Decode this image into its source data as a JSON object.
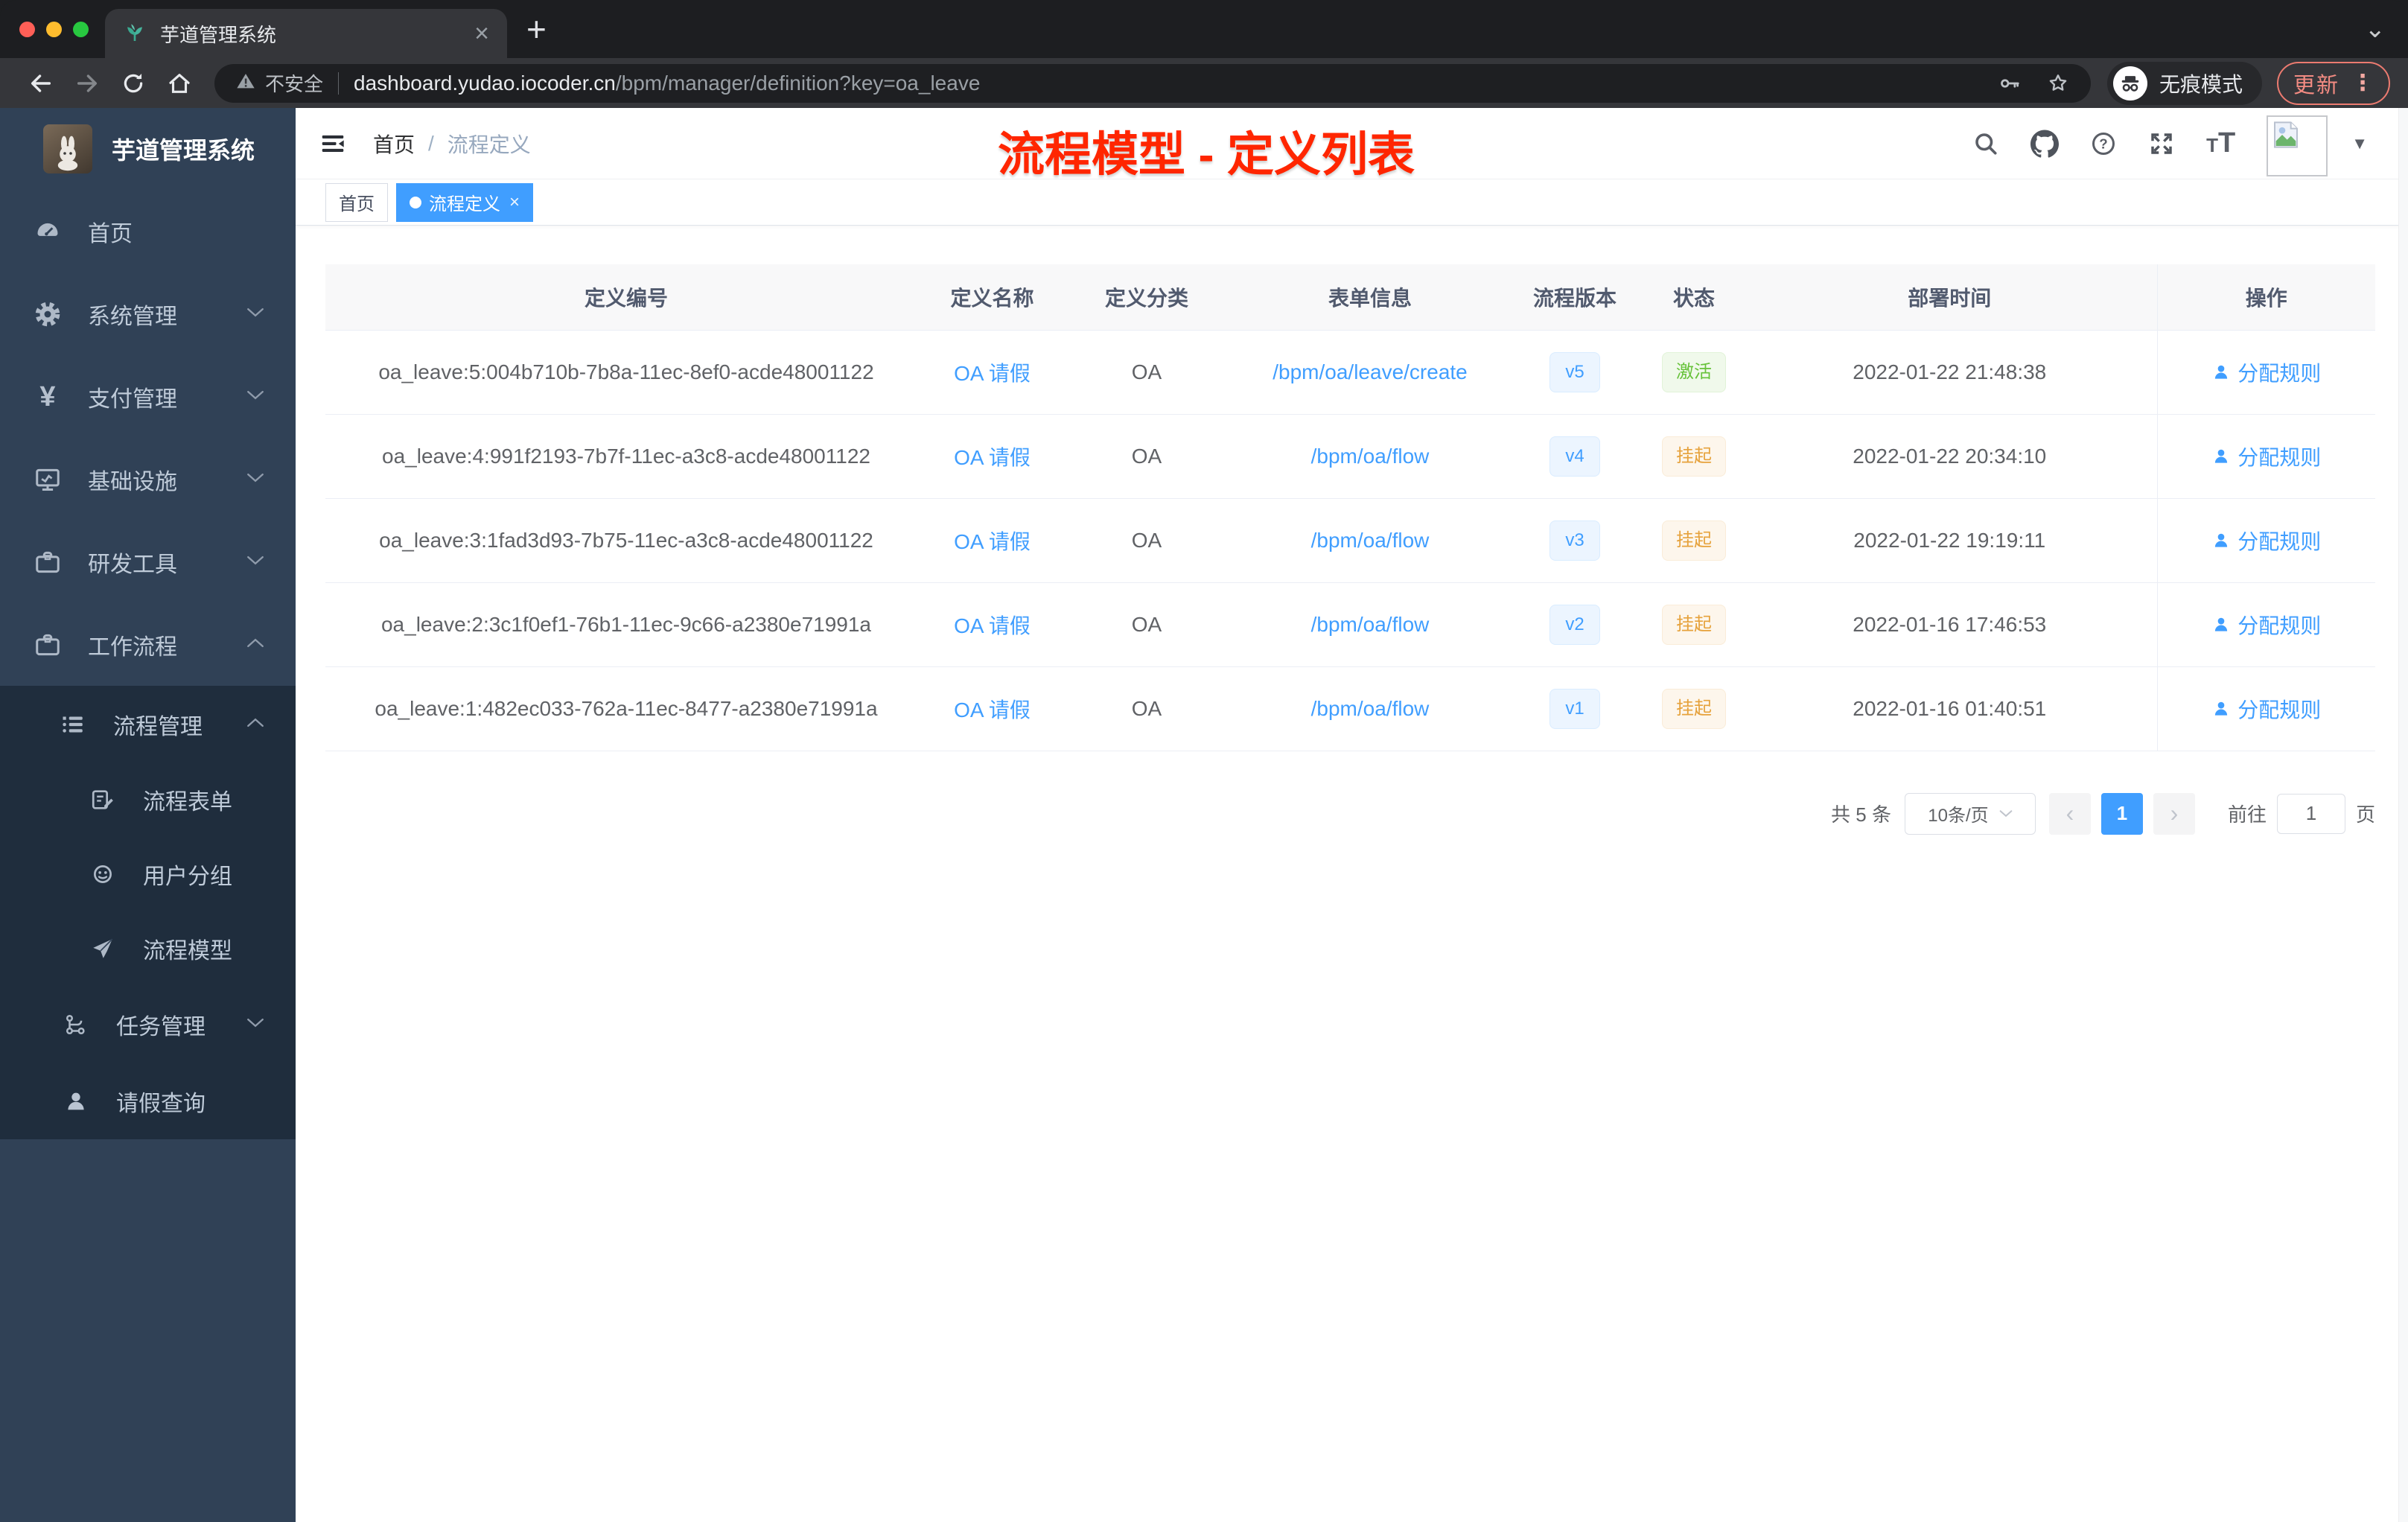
{
  "browser": {
    "tab": {
      "title": "芋道管理系统"
    },
    "toolbar": {
      "security_label": "不安全",
      "url_host": "dashboard.yudao.iocoder.cn",
      "url_path": "/bpm/manager/definition?key=oa_leave",
      "incognito_label": "无痕模式",
      "update_label": "更新"
    }
  },
  "glyphs": {
    "close": "×",
    "plus": "+",
    "chevron_down": "⌄",
    "prev": "‹",
    "next": "›",
    "kebab": "⋮",
    "caret": "▼"
  },
  "sidebar": {
    "app_title": "芋道管理系统",
    "menu": [
      {
        "label": "首页",
        "icon": "dashboard-icon",
        "expandable": false
      },
      {
        "label": "系统管理",
        "icon": "gear-icon",
        "state": "collapsed"
      },
      {
        "label": "支付管理",
        "icon": "yen-icon",
        "state": "collapsed"
      },
      {
        "label": "基础设施",
        "icon": "monitor-icon",
        "state": "collapsed"
      },
      {
        "label": "研发工具",
        "icon": "briefcase-icon",
        "state": "collapsed"
      },
      {
        "label": "工作流程",
        "icon": "briefcase-icon",
        "state": "expanded"
      }
    ],
    "submenu": [
      {
        "label": "流程管理",
        "icon": "tree-list-icon",
        "state": "expanded"
      },
      {
        "label": "流程表单",
        "icon": "form-edit-icon"
      },
      {
        "label": "用户分组",
        "icon": "robot-face-icon"
      },
      {
        "label": "流程模型",
        "icon": "paper-plane-icon"
      },
      {
        "label": "任务管理",
        "icon": "branch-icon",
        "state": "collapsed"
      },
      {
        "label": "请假查询",
        "icon": "user-icon"
      }
    ]
  },
  "header": {
    "breadcrumb": {
      "root": "首页",
      "separator": "/",
      "current": "流程定义"
    },
    "annotation": {
      "text": "流程模型 - 定义列表",
      "color": "#ff2600"
    }
  },
  "tags": {
    "home": "首页",
    "current": "流程定义"
  },
  "table": {
    "columns": [
      "定义编号",
      "定义名称",
      "定义分类",
      "表单信息",
      "流程版本",
      "状态",
      "部署时间",
      "操作"
    ],
    "action_label": "分配规则",
    "rows": [
      {
        "id": "oa_leave:5:004b710b-7b8a-11ec-8ef0-acde48001122",
        "name": "OA 请假",
        "category": "OA",
        "form": "/bpm/oa/leave/create",
        "version": "v5",
        "status": "激活",
        "status_type": "success",
        "deployed": "2022-01-22 21:48:38"
      },
      {
        "id": "oa_leave:4:991f2193-7b7f-11ec-a3c8-acde48001122",
        "name": "OA 请假",
        "category": "OA",
        "form": "/bpm/oa/flow",
        "version": "v4",
        "status": "挂起",
        "status_type": "warning",
        "deployed": "2022-01-22 20:34:10"
      },
      {
        "id": "oa_leave:3:1fad3d93-7b75-11ec-a3c8-acde48001122",
        "name": "OA 请假",
        "category": "OA",
        "form": "/bpm/oa/flow",
        "version": "v3",
        "status": "挂起",
        "status_type": "warning",
        "deployed": "2022-01-22 19:19:11"
      },
      {
        "id": "oa_leave:2:3c1f0ef1-76b1-11ec-9c66-a2380e71991a",
        "name": "OA 请假",
        "category": "OA",
        "form": "/bpm/oa/flow",
        "version": "v2",
        "status": "挂起",
        "status_type": "warning",
        "deployed": "2022-01-16 17:46:53"
      },
      {
        "id": "oa_leave:1:482ec033-762a-11ec-8477-a2380e71991a",
        "name": "OA 请假",
        "category": "OA",
        "form": "/bpm/oa/flow",
        "version": "v1",
        "status": "挂起",
        "status_type": "warning",
        "deployed": "2022-01-16 01:40:51"
      }
    ]
  },
  "pagination": {
    "total": "共 5 条",
    "page_size": "10条/页",
    "page": "1",
    "goto_label": "前往",
    "goto_value": "1",
    "unit": "页"
  },
  "icons": {
    "tab_favicon": "plant-icon",
    "toolbar": [
      "back-arrow-icon",
      "forward-arrow-icon",
      "reload-icon",
      "home-icon",
      "warning-triangle-icon",
      "key-icon",
      "star-icon",
      "incognito-icon",
      "kebab-menu-icon"
    ],
    "sidebar": [
      "dashboard-icon",
      "gear-icon",
      "yen-icon",
      "monitor-icon",
      "briefcase-icon",
      "tree-list-icon",
      "form-edit-icon",
      "robot-face-icon",
      "paper-plane-icon",
      "branch-icon",
      "user-icon",
      "chevron-icon"
    ],
    "navbar": [
      "fold-icon",
      "search-icon",
      "github-icon",
      "question-icon",
      "fullscreen-icon",
      "font-size-icon",
      "broken-image-icon",
      "caret-down-icon"
    ],
    "table_action": "user-icon"
  },
  "colors": {
    "accent": "#409eff",
    "success": "#67c23a",
    "warning": "#e6a23c",
    "sidebar_bg": "#304156",
    "submenu_bg": "#1f2d3d",
    "annotation": "#ff2600",
    "update_red": "#f28b82"
  }
}
